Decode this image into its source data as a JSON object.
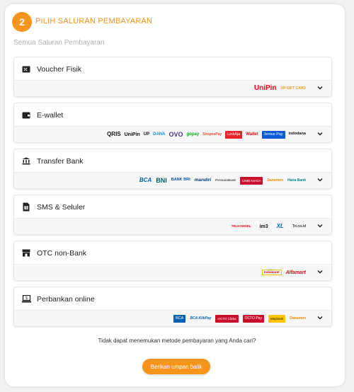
{
  "step": {
    "number": "2",
    "title": "PILIH SALURAN PEMBAYARAN"
  },
  "subtitle": "Semua Saluran Pembayaran",
  "groups": [
    {
      "title": "Voucher Fisik",
      "logos": [
        "UniPin",
        "UP GIFT CARD"
      ]
    },
    {
      "title": "E-wallet",
      "logos": [
        "QRIS",
        "UniPin",
        "UP",
        "DANA",
        "OVO",
        "gopay",
        "ShopeePay",
        "LinkAja",
        "Wallet",
        "Jenius Pay",
        "indodana"
      ]
    },
    {
      "title": "Transfer Bank",
      "logos": [
        "BCA",
        "BNI",
        "BANK BRI",
        "mandiri",
        "PermataBank",
        "CIMB NIAGA",
        "Danamon",
        "Hana Bank"
      ]
    },
    {
      "title": "SMS & Seluler",
      "logos": [
        "TELKOMSEL",
        "im3",
        "XL",
        "Tri.co.id"
      ]
    },
    {
      "title": "OTC non-Bank",
      "logos": [
        "Indomaret",
        "Alfamart"
      ]
    },
    {
      "title": "Perbankan online",
      "logos": [
        "BCA",
        "BCA KlikPay",
        "OCTO Clicks",
        "OCTO Pay",
        "Maybank",
        "Danamon"
      ]
    }
  ],
  "footer": {
    "question": "Tidak dapat menemukan metode pembayaran yang Anda cari?",
    "feedback_label": "Berikan umpan balik"
  },
  "colors": {
    "accent": "#f7941d"
  }
}
